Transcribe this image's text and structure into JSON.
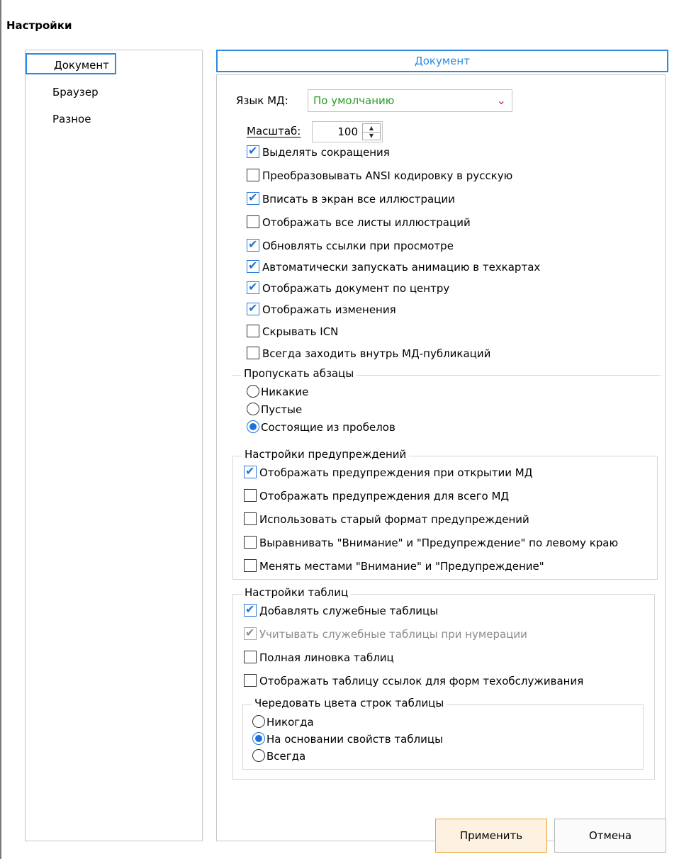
{
  "window": {
    "title": "Настройки"
  },
  "nav": {
    "items": [
      {
        "label": "Документ",
        "selected": true
      },
      {
        "label": "Браузер",
        "selected": false
      },
      {
        "label": "Разное",
        "selected": false
      }
    ]
  },
  "page": {
    "header": "Документ"
  },
  "language": {
    "label": "Язык МД:",
    "value": "По умолчанию",
    "value_color": "#2a9a2a"
  },
  "scale": {
    "label": "Масштаб:",
    "value": "100"
  },
  "options": [
    {
      "label": "Выделять сокращения",
      "checked": true
    },
    {
      "label": "Преобразовывать ANSI кодировку в русскую",
      "checked": false
    },
    {
      "label": "Вписать в экран все иллюстрации",
      "checked": true
    },
    {
      "label": "Отображать все листы иллюстраций",
      "checked": false
    },
    {
      "label": "Обновлять ссылки при просмотре",
      "checked": true
    },
    {
      "label": "Автоматически запускать анимацию в техкартах",
      "checked": true
    },
    {
      "label": "Отображать документ по центру",
      "checked": true
    },
    {
      "label": "Отображать изменения",
      "checked": true
    },
    {
      "label": "Скрывать ICN",
      "checked": false
    },
    {
      "label": "Всегда заходить внутрь МД-публикаций",
      "checked": false
    }
  ],
  "skip_paragraphs": {
    "title": "Пропускать абзацы",
    "options": [
      {
        "label": "Никакие",
        "selected": false
      },
      {
        "label": "Пустые",
        "selected": false
      },
      {
        "label": "Состоящие из пробелов",
        "selected": true
      }
    ]
  },
  "warnings": {
    "title": "Настройки предупреждений",
    "options": [
      {
        "label": "Отображать предупреждения при открытии МД",
        "checked": true
      },
      {
        "label": "Отображать предупреждения для всего МД",
        "checked": false
      },
      {
        "label": "Использовать старый формат предупреждений",
        "checked": false
      },
      {
        "label": "Выравнивать \"Внимание\" и \"Предупреждение\" по левому краю",
        "checked": false
      },
      {
        "label": "Менять местами \"Внимание\" и \"Предупреждение\"",
        "checked": false
      }
    ]
  },
  "tables": {
    "title": "Настройки таблиц",
    "options": [
      {
        "label": "Добавлять служебные таблицы",
        "checked": true,
        "disabled": false
      },
      {
        "label": "Учитывать служебные таблицы при нумерации",
        "checked": true,
        "disabled": true
      },
      {
        "label": "Полная линовка таблиц",
        "checked": false,
        "disabled": false
      },
      {
        "label": "Отображать таблицу ссылок для форм техобслуживания",
        "checked": false,
        "disabled": false
      }
    ],
    "row_colors": {
      "title": "Чередовать цвета строк таблицы",
      "options": [
        {
          "label": "Никогда",
          "selected": false
        },
        {
          "label": "На основании свойств таблицы",
          "selected": true
        },
        {
          "label": "Всегда",
          "selected": false
        }
      ]
    }
  },
  "buttons": {
    "apply": "Применить",
    "cancel": "Отмена"
  },
  "colors": {
    "accent": "#2c8ae0",
    "apply_border": "#f0a030",
    "apply_bg": "#fdf2e2",
    "dropdown_chevron": "#d0187a"
  }
}
